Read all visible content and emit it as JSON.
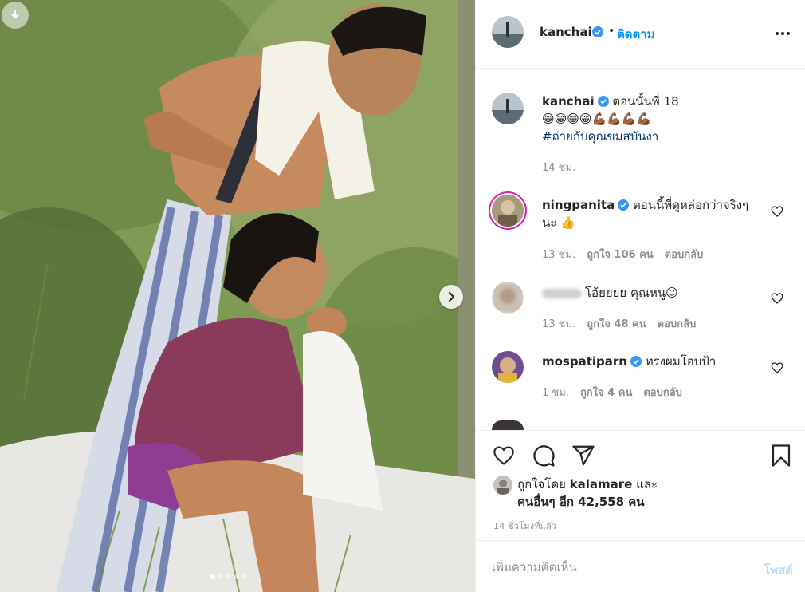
{
  "header": {
    "username": "kanchai",
    "separator": "•",
    "follow_label": "ติดตาม"
  },
  "caption": {
    "username": "kanchai",
    "text": "ตอนนั้นพี่ 18",
    "emojis": "😁😁😁😁💪🏾💪🏾💪🏾💪🏾",
    "hashtag": "#ถ่ายกับคุณขมสบันงา",
    "time": "14 ชม."
  },
  "comments": [
    {
      "username": "ningpanita",
      "verified": true,
      "text": "ตอนนี้พี่ดูหล่อกว่าจริงๆนะ 👍",
      "time": "13 ชม.",
      "likes": "ถูกใจ 106 คน",
      "reply": "ตอบกลับ"
    },
    {
      "username": "",
      "verified": false,
      "text": "โอ้ยยยย คุณหนู☺",
      "time": "13 ชม.",
      "likes": "ถูกใจ 48 คน",
      "reply": "ตอบกลับ"
    },
    {
      "username": "mospatiparn",
      "verified": true,
      "text": "ทรงผมโอบป้า",
      "time": "1 ชม.",
      "likes": "ถูกใจ 4 คน",
      "reply": "ตอบกลับ"
    }
  ],
  "likes": {
    "prefix": "ถูกใจโดย",
    "liker": "kalamare",
    "and": "และ",
    "others": "คนอื่นๆ อีก 42,558 คน"
  },
  "post_time": "14 ชั่วโมงที่แล้ว",
  "add_comment": {
    "placeholder": "เพิ่มความคิดเห็น",
    "post_label": "โพสต์"
  },
  "carousel": {
    "total": 5,
    "current": 1
  },
  "colors": {
    "accent": "#0095f6",
    "verified": "#3897f0",
    "post_disabled": "#b2dffc",
    "muted": "#8e8e8e",
    "hashtag": "#00376b"
  },
  "icons": [
    "download-icon",
    "chevron-right-icon",
    "more-icon",
    "verified-icon",
    "heart-icon",
    "comment-icon",
    "share-icon",
    "bookmark-icon"
  ]
}
